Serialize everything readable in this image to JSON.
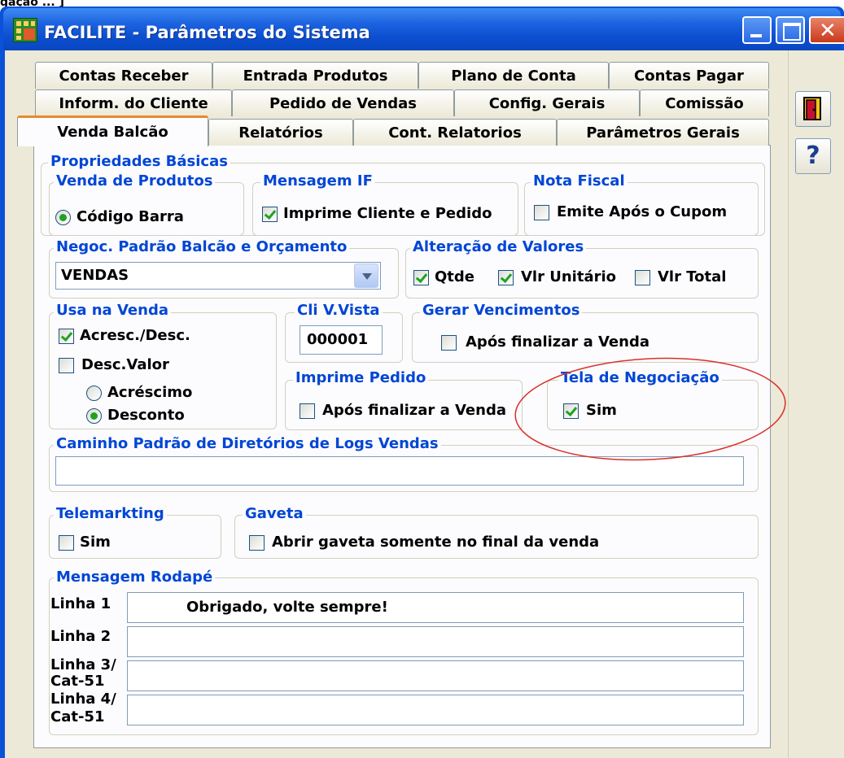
{
  "top_crop_text": "gação ... ]",
  "window": {
    "title": "FACILITE - Parâmetros do Sistema"
  },
  "tabs": {
    "row1": [
      "Contas Receber",
      "Entrada Produtos",
      "Plano de Conta",
      "Contas Pagar"
    ],
    "row2": [
      "Inform. do Cliente",
      "Pedido de Vendas",
      "Config. Gerais",
      "Comissão"
    ],
    "row3": [
      "Venda Balcão",
      "Relatórios",
      "Cont. Relatorios",
      "Parâmetros Gerais"
    ],
    "active": "Venda Balcão"
  },
  "propriedades_basicas": {
    "title": "Propriedades Básicas",
    "venda_produtos": {
      "title": "Venda de Produtos",
      "option": "Código Barra",
      "selected": true
    },
    "mensagem_if": {
      "title": "Mensagem IF",
      "checkbox": "Imprime Cliente e Pedido",
      "checked": true
    },
    "nota_fiscal": {
      "title": "Nota Fiscal",
      "checkbox": "Emite Após o Cupom",
      "checked": false
    }
  },
  "negociacao": {
    "title": "Negoc. Padrão Balcão e Orçamento",
    "value": "VENDAS"
  },
  "alteracao_valores": {
    "title": "Alteração de Valores",
    "items": [
      {
        "label": "Qtde",
        "checked": true
      },
      {
        "label": "Vlr Unitário",
        "checked": true
      },
      {
        "label": "Vlr Total",
        "checked": false
      }
    ]
  },
  "usa_na_venda": {
    "title": "Usa na Venda",
    "acresc_desc": {
      "label": "Acresc./Desc.",
      "checked": true
    },
    "desc_valor": {
      "label": "Desc.Valor",
      "checked": false
    },
    "radios": [
      {
        "label": "Acréscimo",
        "selected": false
      },
      {
        "label": "Desconto",
        "selected": true
      }
    ]
  },
  "cli_vista": {
    "title": "Cli V.Vista",
    "value": "000001"
  },
  "gerar_vencimentos": {
    "title": "Gerar Vencimentos",
    "checkbox": "Após finalizar a Venda",
    "checked": false
  },
  "imprime_pedido": {
    "title": "Imprime Pedido",
    "checkbox": "Após finalizar a Venda",
    "checked": false
  },
  "tela_negociacao": {
    "title": "Tela de Negociação",
    "checkbox": "Sim",
    "checked": true,
    "highlight_color": "#d9302a"
  },
  "caminho_logs": {
    "title": "Caminho Padrão de Diretórios de Logs Vendas",
    "value": ""
  },
  "telemarkting": {
    "title": "Telemarkting",
    "checkbox": "Sim",
    "checked": false
  },
  "gaveta": {
    "title": "Gaveta",
    "checkbox": "Abrir gaveta somente no final da venda",
    "checked": false
  },
  "mensagem_rodape": {
    "title": "Mensagem Rodapé",
    "lines": [
      {
        "label": "Linha 1",
        "value": "Obrigado, volte sempre!"
      },
      {
        "label": "Linha 2",
        "value": ""
      },
      {
        "label1": "Linha 3/",
        "label2": "Cat-51",
        "value": ""
      },
      {
        "label1": "Linha 4/",
        "label2": "Cat-51",
        "value": ""
      }
    ]
  },
  "side_buttons": {
    "exit_icon": "door-exit-icon",
    "help_icon": "question-mark-icon"
  },
  "colors": {
    "titlebar": "#0a53d8",
    "legend": "#0046d5",
    "check": "#21a121",
    "panel": "#ece9d8"
  }
}
